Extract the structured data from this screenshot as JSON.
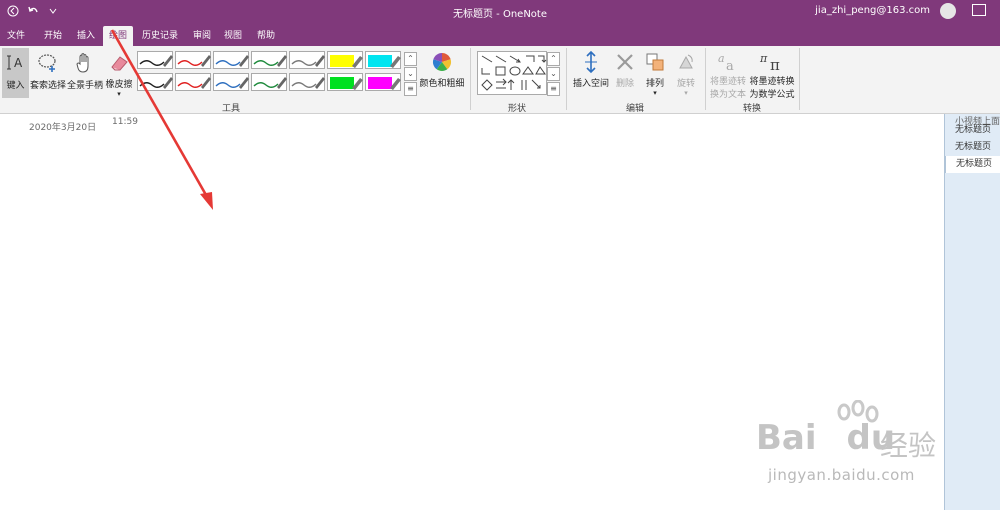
{
  "window": {
    "title": "无标题页 - OneNote",
    "user_email": "jia_zhi_peng@163.com"
  },
  "tabs": [
    "文件",
    "开始",
    "插入",
    "绘图",
    "历史记录",
    "审阅",
    "视图",
    "帮助"
  ],
  "active_tab": "绘图",
  "ribbon": {
    "tools": {
      "type_label": "键入",
      "lasso_label": "套索选择",
      "pan_label": "全景手柄",
      "eraser_label": "橡皮擦",
      "color_width_label": "颜色和粗细",
      "group_label": "工具"
    },
    "pens": [
      {
        "color": "#1f1f1f",
        "kind": "pen"
      },
      {
        "color": "#e02020",
        "kind": "pen"
      },
      {
        "color": "#2e6fbf",
        "kind": "pen"
      },
      {
        "color": "#1e8a3c",
        "kind": "pen"
      },
      {
        "color": "#7a7a7a",
        "kind": "pen"
      },
      {
        "color": "#ffff00",
        "kind": "highlighter"
      },
      {
        "color": "#00e5f0",
        "kind": "highlighter"
      },
      {
        "color": "#1f1f1f",
        "kind": "pen"
      },
      {
        "color": "#e02020",
        "kind": "pen"
      },
      {
        "color": "#2e6fbf",
        "kind": "pen"
      },
      {
        "color": "#1e8a3c",
        "kind": "pen"
      },
      {
        "color": "#7a7a7a",
        "kind": "pen"
      },
      {
        "color": "#00e020",
        "kind": "highlighter"
      },
      {
        "color": "#ff00ff",
        "kind": "highlighter"
      }
    ],
    "shapes": {
      "group_label": "形状"
    },
    "edit": {
      "insert_space_label": "插入空间",
      "delete_label": "删除",
      "arrange_label": "排列",
      "rotate_label": "旋转",
      "group_label": "编辑"
    },
    "convert": {
      "ink_to_text_line1": "将墨迹转",
      "ink_to_text_line2": "换为文本",
      "ink_to_math_line1": "将墨迹转换",
      "ink_to_math_line2": "为数学公式",
      "group_label": "转换"
    }
  },
  "note": {
    "date": "2020年3月20日",
    "time": "11:59"
  },
  "pages": [
    {
      "label": "小视频上面",
      "active": false
    },
    {
      "label": "无标题页",
      "active": false
    },
    {
      "label": "无标题页",
      "active": false
    },
    {
      "label": "无标题页",
      "active": true
    }
  ],
  "annotation": {
    "arrow_color": "#e53935"
  },
  "watermark": {
    "brand": "Bai",
    "brand_tail": "du",
    "cn": "经验",
    "url": "jingyan.baidu.com"
  }
}
